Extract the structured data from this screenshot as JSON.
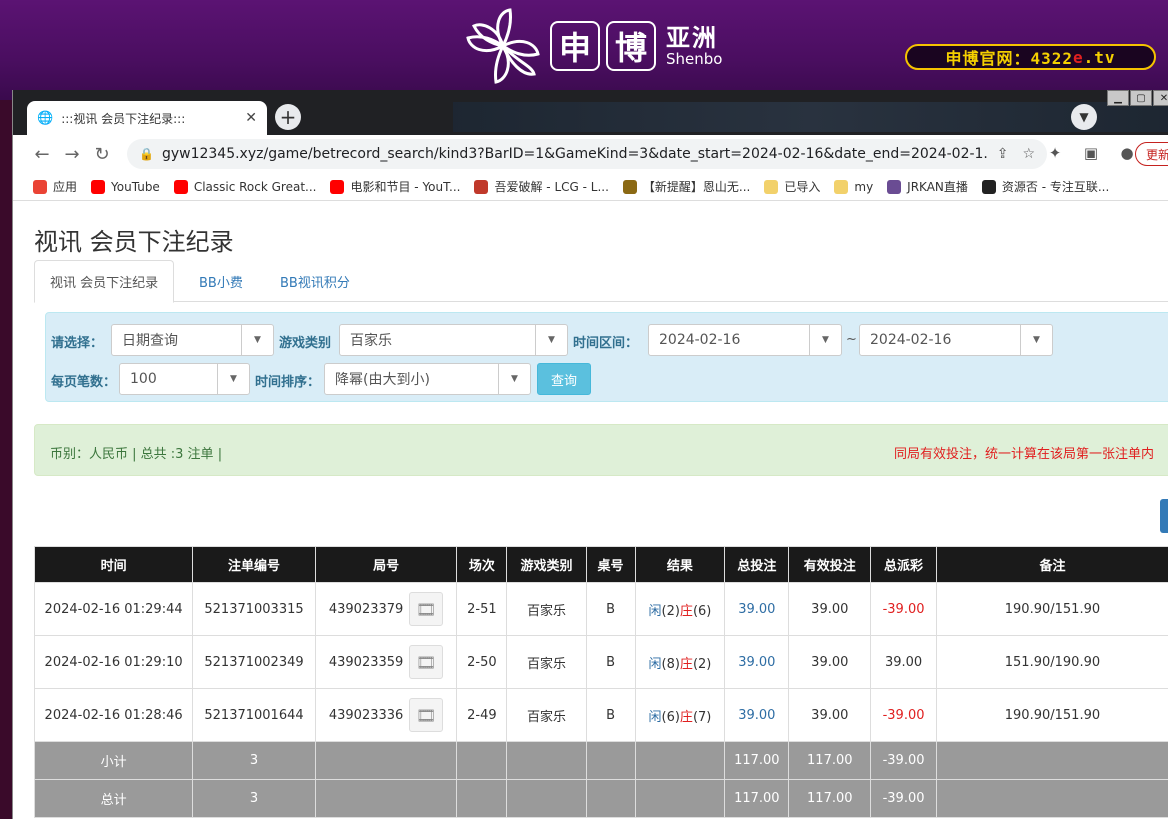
{
  "site": {
    "logo_char_1": "申",
    "logo_char_2": "博",
    "logo_cn": "亚洲",
    "logo_en": "Shenbo",
    "official_prefix": "申博官网：4322",
    "official_red": "e",
    "official_suffix": ".tv"
  },
  "browser": {
    "tab_title": ":::视讯 会员下注纪录:::",
    "url": "gyw12345.xyz/game/betrecord_search/kind3?BarID=1&GameKind=3&date_start=2024-02-16&date_end=2024-02-1...",
    "update_label": "更新",
    "bookmarks": [
      {
        "label": "应用",
        "color": "#ea4335"
      },
      {
        "label": "YouTube",
        "color": "#ff0000"
      },
      {
        "label": "Classic Rock Great...",
        "color": "#ff0000"
      },
      {
        "label": "电影和节目 - YouT...",
        "color": "#ff0000"
      },
      {
        "label": "吾爱破解 - LCG - L...",
        "color": "#c0392b"
      },
      {
        "label": "【新提醒】恩山无...",
        "color": "#8b6914"
      },
      {
        "label": "已导入",
        "color": "#f2d16b"
      },
      {
        "label": "my",
        "color": "#f2d16b"
      },
      {
        "label": "JRKAN直播",
        "color": "#6a4c93"
      },
      {
        "label": "资源否 - 专注互联...",
        "color": "#222222"
      }
    ]
  },
  "page": {
    "title": "视讯 会员下注纪录",
    "tabs": [
      "视讯 会员下注纪录",
      "BB小费",
      "BB视讯积分"
    ]
  },
  "filter": {
    "select_label": "请选择：",
    "select_value": "日期查询",
    "game_type_label": "游戏类别",
    "game_type_value": "百家乐",
    "time_range_label": "时间区间：",
    "date_start": "2024-02-16",
    "tilde": "~",
    "date_end": "2024-02-16",
    "per_page_label": "每页笔数：",
    "per_page_value": "100",
    "sort_label": "时间排序：",
    "sort_value": "降幂(由大到小)",
    "query_button": "查询"
  },
  "summary": {
    "left": "币别：人民币 | 总共 :3 注单 |",
    "right": "同局有效投注，统一计算在该局第一张注单内"
  },
  "table": {
    "headers": [
      "时间",
      "注单编号",
      "局号",
      "场次",
      "游戏类别",
      "桌号",
      "结果",
      "总投注",
      "有效投注",
      "总派彩",
      "备注"
    ],
    "rows": [
      {
        "time": "2024-02-16 01:29:44",
        "bet_no": "521371003315",
        "round": "439023379",
        "game_no": "2-51",
        "type": "百家乐",
        "table": "B",
        "player": "闲",
        "player_n": "(2)",
        "banker": "庄",
        "banker_n": "(6)",
        "total_bet": "39.00",
        "valid_bet": "39.00",
        "payout": "-39.00",
        "payout_negative": true,
        "remark": "190.90/151.90"
      },
      {
        "time": "2024-02-16 01:29:10",
        "bet_no": "521371002349",
        "round": "439023359",
        "game_no": "2-50",
        "type": "百家乐",
        "table": "B",
        "player": "闲",
        "player_n": "(8)",
        "banker": "庄",
        "banker_n": "(2)",
        "total_bet": "39.00",
        "valid_bet": "39.00",
        "payout": "39.00",
        "payout_negative": false,
        "remark": "151.90/190.90"
      },
      {
        "time": "2024-02-16 01:28:46",
        "bet_no": "521371001644",
        "round": "439023336",
        "game_no": "2-49",
        "type": "百家乐",
        "table": "B",
        "player": "闲",
        "player_n": "(6)",
        "banker": "庄",
        "banker_n": "(7)",
        "total_bet": "39.00",
        "valid_bet": "39.00",
        "payout": "-39.00",
        "payout_negative": true,
        "remark": "190.90/151.90"
      }
    ],
    "subtotal": {
      "label": "小计",
      "count": "3",
      "total_bet": "117.00",
      "valid_bet": "117.00",
      "payout": "-39.00"
    },
    "total": {
      "label": "总计",
      "count": "3",
      "total_bet": "117.00",
      "valid_bet": "117.00",
      "payout": "-39.00"
    }
  }
}
